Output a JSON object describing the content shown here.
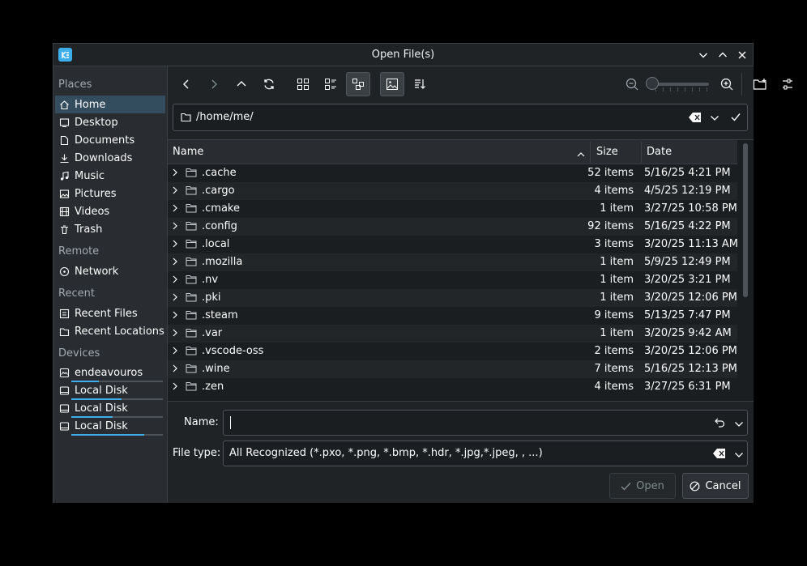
{
  "window": {
    "title": "Open File(s)"
  },
  "sidebar": {
    "places_header": "Places",
    "places": [
      {
        "label": "Home",
        "icon": "home-icon",
        "selected": true
      },
      {
        "label": "Desktop",
        "icon": "desktop-icon"
      },
      {
        "label": "Documents",
        "icon": "documents-icon"
      },
      {
        "label": "Downloads",
        "icon": "downloads-icon"
      },
      {
        "label": "Music",
        "icon": "music-icon"
      },
      {
        "label": "Pictures",
        "icon": "pictures-icon"
      },
      {
        "label": "Videos",
        "icon": "videos-icon"
      },
      {
        "label": "Trash",
        "icon": "trash-icon"
      }
    ],
    "remote_header": "Remote",
    "remote": [
      {
        "label": "Network",
        "icon": "network-icon"
      }
    ],
    "recent_header": "Recent",
    "recent": [
      {
        "label": "Recent Files",
        "icon": "recent-files-icon"
      },
      {
        "label": "Recent Locations",
        "icon": "recent-locations-icon"
      }
    ],
    "devices_header": "Devices",
    "devices": [
      {
        "label": "endeavouros",
        "icon": "drive-icon",
        "usage": 0.3
      },
      {
        "label": "Local Disk",
        "icon": "drive-icon",
        "usage": 0.55
      },
      {
        "label": "Local Disk",
        "icon": "drive-icon",
        "usage": 0.45
      },
      {
        "label": "Local Disk",
        "icon": "drive-icon",
        "usage": 0.8
      }
    ]
  },
  "location": {
    "path": "/home/me/"
  },
  "columns": {
    "name": "Name",
    "size": "Size",
    "date": "Date"
  },
  "files": [
    {
      "name": ".cache",
      "size": "52 items",
      "date": "5/16/25 4:21 PM"
    },
    {
      "name": ".cargo",
      "size": "4 items",
      "date": "4/5/25 12:19 PM"
    },
    {
      "name": ".cmake",
      "size": "1 item",
      "date": "3/27/25 10:58 PM"
    },
    {
      "name": ".config",
      "size": "92 items",
      "date": "5/16/25 4:22 PM"
    },
    {
      "name": ".local",
      "size": "3 items",
      "date": "3/20/25 11:13 AM"
    },
    {
      "name": ".mozilla",
      "size": "1 item",
      "date": "5/9/25 12:49 PM"
    },
    {
      "name": ".nv",
      "size": "1 item",
      "date": "3/20/25 3:21 PM"
    },
    {
      "name": ".pki",
      "size": "1 item",
      "date": "3/20/25 12:06 PM"
    },
    {
      "name": ".steam",
      "size": "9 items",
      "date": "5/13/25 7:47 PM"
    },
    {
      "name": ".var",
      "size": "1 item",
      "date": "3/20/25 9:42 AM"
    },
    {
      "name": ".vscode-oss",
      "size": "2 items",
      "date": "3/20/25 12:06 PM"
    },
    {
      "name": ".wine",
      "size": "7 items",
      "date": "5/16/25 12:13 PM"
    },
    {
      "name": ".zen",
      "size": "4 items",
      "date": "3/27/25 6:31 PM"
    }
  ],
  "bottom": {
    "name_label": "Name:",
    "name_value": "",
    "filetype_label": "File type:",
    "filetype_value": "All Recognized (*.pxo, *.png, *.bmp, *.hdr, *.jpg,*.jpeg, , ...)",
    "open_label": "Open",
    "cancel_label": "Cancel"
  },
  "colors": {
    "accent": "#3daee9",
    "background": "#202326",
    "selected": "#334c5e"
  }
}
